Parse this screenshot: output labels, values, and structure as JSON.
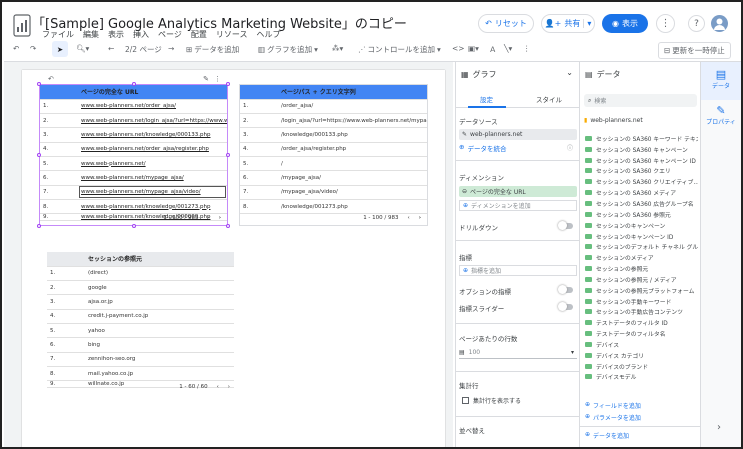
{
  "app": {
    "title": "「[Sample] Google Analytics Marketing Website」のコピー",
    "menu": [
      "ファイル",
      "編集",
      "表示",
      "挿入",
      "ページ",
      "配置",
      "リソース",
      "ヘルプ"
    ],
    "reset_label": "リセット",
    "share_label": "共有",
    "view_label": "表示"
  },
  "toolbar": {
    "page_indicator": "2/2 ページ",
    "add_data": "データを追加",
    "add_chart": "グラフを追加",
    "add_control": "コントロールを追加",
    "pause_updates": "更新を一時停止"
  },
  "table1": {
    "header": "ページの完全な URL",
    "rows": [
      {
        "n": "1.",
        "v": "www.web-planners.net/order_ajsa/"
      },
      {
        "n": "2.",
        "v": "www.web-planners.net/login_ajsa/?url=https://www.we..."
      },
      {
        "n": "3.",
        "v": "www.web-planners.net/knowledge/000133.php"
      },
      {
        "n": "4.",
        "v": "www.web-planners.net/order_ajsa/register.php"
      },
      {
        "n": "5.",
        "v": "www.web-planners.net/"
      },
      {
        "n": "6.",
        "v": "www.web-planners.net/mypage_ajsa/"
      },
      {
        "n": "7.",
        "v": "www.web-planners.net/mypage_ajsa/video/"
      },
      {
        "n": "8.",
        "v": "www.web-planners.net/knowledge/001273.php"
      },
      {
        "n": "9.",
        "v": "www.web-planners.net/knowledge/000000.php"
      }
    ],
    "pager": "1 - 100 / 983"
  },
  "table2": {
    "header": "ページパス + クエリ文字列",
    "rows": [
      {
        "n": "1.",
        "v": "/order_ajsa/"
      },
      {
        "n": "2.",
        "v": "/login_ajsa/?url=https://www.web-planners.net/mypag..."
      },
      {
        "n": "3.",
        "v": "/knowledge/000133.php"
      },
      {
        "n": "4.",
        "v": "/order_ajsa/register.php"
      },
      {
        "n": "5.",
        "v": "/"
      },
      {
        "n": "6.",
        "v": "/mypage_ajsa/"
      },
      {
        "n": "7.",
        "v": "/mypage_ajsa/video/"
      },
      {
        "n": "8.",
        "v": "/knowledge/001273.php"
      }
    ],
    "pager": "1 - 100 / 983"
  },
  "table3": {
    "header": "セッションの参照元",
    "rows": [
      {
        "n": "1.",
        "v": "(direct)"
      },
      {
        "n": "2.",
        "v": "google"
      },
      {
        "n": "3.",
        "v": "ajsa.or.jp"
      },
      {
        "n": "4.",
        "v": "credit.j-payment.co.jp"
      },
      {
        "n": "5.",
        "v": "yahoo"
      },
      {
        "n": "6.",
        "v": "bing"
      },
      {
        "n": "7.",
        "v": "zennihon-seo.org"
      },
      {
        "n": "8.",
        "v": "mail.yahoo.co.jp"
      },
      {
        "n": "9.",
        "v": "willnate.co.jp"
      }
    ],
    "pager": "1 - 60 / 60"
  },
  "panel": {
    "title": "グラフ",
    "tab_setup": "設定",
    "tab_style": "スタイル",
    "datasource_label": "データソース",
    "datasource_value": "web-planners.net",
    "blend_label": "データを統合",
    "dimension_label": "ディメンション",
    "dimension_value": "ページの完全な URL",
    "add_dimension": "ディメンションを追加",
    "drilldown": "ドリルダウン",
    "metric_label": "指標",
    "add_metric": "指標を追加",
    "optional_metric": "オプションの指標",
    "metric_slider": "指標スライダー",
    "rows_per_page": "ページあたりの行数",
    "rows_value": "100",
    "summary_row": "集計行",
    "show_summary": "集計行を表示する",
    "sort": "並べ替え"
  },
  "data_panel": {
    "title": "データ",
    "search_placeholder": "検索",
    "source": "web-planners.net",
    "fields": [
      "セッションの SA360 キーワード テキスト",
      "セッションの SA360 キャンペーン",
      "セッションの SA360 キャンペーン ID",
      "セッションの SA360 クエリ",
      "セッションの SA360 クリエイティブ...",
      "セッションの SA360 メディア",
      "セッションの SA360 広告グループ名",
      "セッションの SA360 参照元",
      "セッションのキャンペーン",
      "セッションのキャンペーン ID",
      "セッションのデフォルト チャネル グル...",
      "セッションのメディア",
      "セッションの参照元",
      "セッションの参照元 / メディア",
      "セッションの参照元プラットフォーム",
      "セッションの手動キーワード",
      "セッションの手動広告コンテンツ",
      "テストデータのフィルタ ID",
      "テストデータのフィルタ名",
      "デバイス",
      "デバイス カテゴリ",
      "デバイスのブランド",
      "デバイスモデル"
    ],
    "add_field": "フィールドを追加",
    "add_parameter": "パラメータを追加",
    "add_data": "データを追加"
  },
  "rail": {
    "data": "データ",
    "properties": "プロパティ"
  }
}
